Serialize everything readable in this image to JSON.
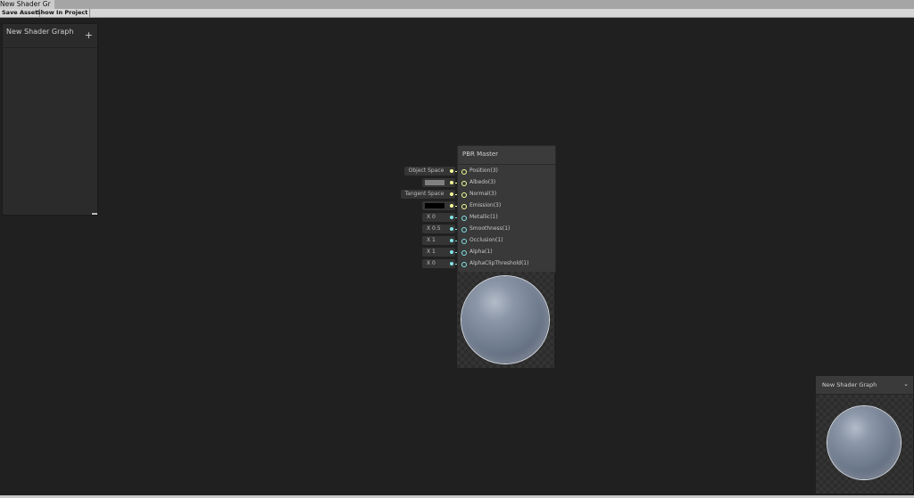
{
  "window": {
    "tab_title": "New Shader Gr"
  },
  "toolbar": {
    "save_label": "Save Asset",
    "show_label": "Show In Project"
  },
  "blackboard": {
    "title": "New Shader Graph",
    "subtitle": "",
    "add_icon": "plus-icon"
  },
  "master_node": {
    "title": "PBR Master",
    "ports": [
      {
        "label": "Position(3)",
        "color": "#f6ff9a"
      },
      {
        "label": "Albedo(3)",
        "color": "#f6ff9a"
      },
      {
        "label": "Normal(3)",
        "color": "#f6ff9a"
      },
      {
        "label": "Emission(3)",
        "color": "#f6ff9a"
      },
      {
        "label": "Metallic(1)",
        "color": "#84e4e7"
      },
      {
        "label": "Smoothness(1)",
        "color": "#84e4e7"
      },
      {
        "label": "Occlusion(1)",
        "color": "#84e4e7"
      },
      {
        "label": "Alpha(1)",
        "color": "#84e4e7"
      },
      {
        "label": "AlphaClipThreshold(1)",
        "color": "#84e4e7"
      }
    ],
    "inputs": {
      "position": "Object Space",
      "albedo_color": "#808080",
      "normal": "Tangent Space",
      "emission_color": "#000000",
      "metallic": "X  0",
      "smoothness": "X  0.5",
      "occlusion": "X  1",
      "alpha": "X  1",
      "alpha_clip": "X  0"
    }
  },
  "main_preview": {
    "title": "New Shader Graph",
    "chevron_icon": "chevron-down-icon"
  }
}
